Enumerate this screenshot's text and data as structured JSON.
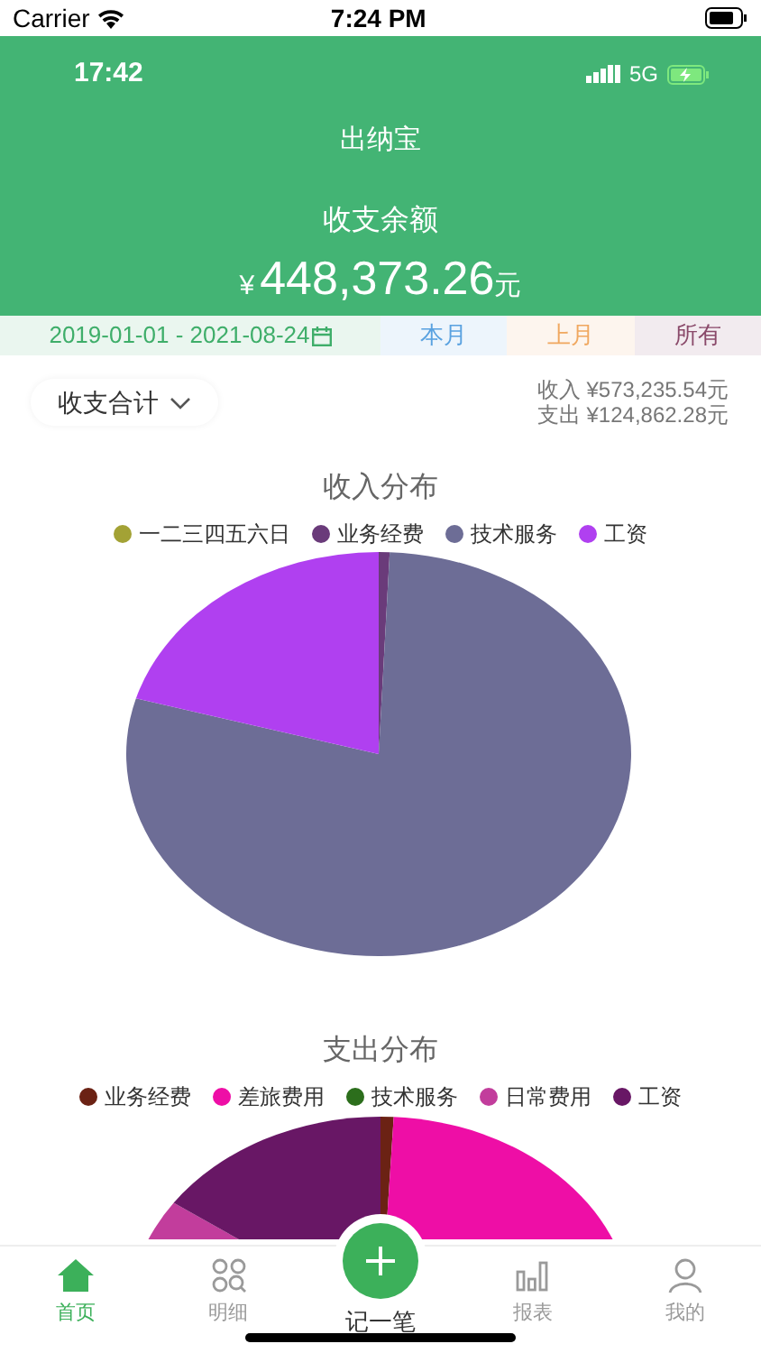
{
  "device_status_bar": {
    "carrier": "Carrier",
    "time": "7:24 PM"
  },
  "app_status_bar": {
    "time": "17:42",
    "network": "5G"
  },
  "header": {
    "title": "出纳宝",
    "balance_label": "收支余额",
    "currency": "¥",
    "balance": "448,373.26",
    "unit": "元"
  },
  "period_filters": [
    {
      "label": "2019-01-01 - 2021-08-24",
      "kind": "range",
      "color": "#3fae6a"
    },
    {
      "label": "本月",
      "kind": "preset",
      "color": "#5aa2e0"
    },
    {
      "label": "上月",
      "kind": "preset",
      "color": "#f0a860"
    },
    {
      "label": "所有",
      "kind": "preset",
      "color": "#8a4a6a"
    }
  ],
  "summary": {
    "dropdown": "收支合计",
    "income": "收入 ¥573,235.54元",
    "expense": "支出 ¥124,862.28元"
  },
  "income_chart": {
    "title": "收入分布",
    "legend": [
      {
        "label": "一二三四五六日",
        "color": "#a3a235"
      },
      {
        "label": "业务经费",
        "color": "#6a3b7a"
      },
      {
        "label": "技术服务",
        "color": "#6d6d96"
      },
      {
        "label": "工资",
        "color": "#b040f0"
      }
    ]
  },
  "expense_chart": {
    "title": "支出分布",
    "legend": [
      {
        "label": "业务经费",
        "color": "#6b2214"
      },
      {
        "label": "差旅费用",
        "color": "#ee0ea6"
      },
      {
        "label": "技术服务",
        "color": "#2c6e1c"
      },
      {
        "label": "日常费用",
        "color": "#c23d9c"
      },
      {
        "label": "工资",
        "color": "#681765"
      }
    ]
  },
  "tab_bar": [
    {
      "label": "首页",
      "kind": "tab",
      "selected": true
    },
    {
      "label": "明细",
      "kind": "tab",
      "selected": false
    },
    {
      "label": "记一笔",
      "kind": "add",
      "selected": false
    },
    {
      "label": "报表",
      "kind": "tab",
      "selected": false
    },
    {
      "label": "我的",
      "kind": "tab",
      "selected": false
    }
  ]
}
